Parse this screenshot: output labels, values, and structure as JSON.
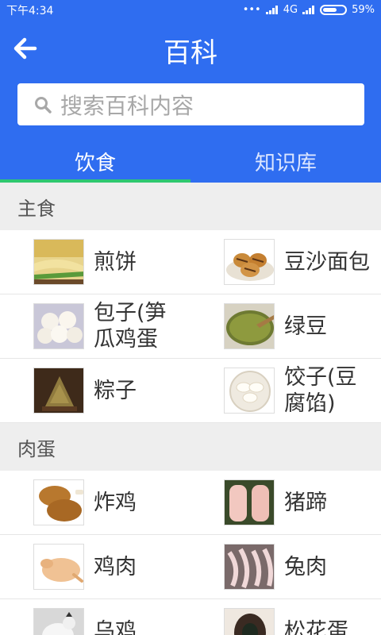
{
  "status": {
    "time": "下午4:34",
    "network": "4G",
    "battery": "59%"
  },
  "header": {
    "title": "百科",
    "back_icon": "arrow-left-icon"
  },
  "search": {
    "placeholder": "搜索百科内容",
    "icon": "search-icon"
  },
  "tabs": [
    {
      "label": "饮食",
      "active": true
    },
    {
      "label": "知识库",
      "active": false
    }
  ],
  "colors": {
    "primary": "#2f6df0",
    "indicator": "#2ec870",
    "section_bg": "#eeeeee"
  },
  "sections": [
    {
      "title": "主食",
      "rows": [
        [
          {
            "label": "煎饼"
          },
          {
            "label": "豆沙面包"
          }
        ],
        [
          {
            "label": "包子(笋瓜鸡蛋馅)"
          },
          {
            "label": "绿豆"
          }
        ],
        [
          {
            "label": "粽子"
          },
          {
            "label": "饺子(豆腐馅)"
          }
        ]
      ]
    },
    {
      "title": "肉蛋",
      "rows": [
        [
          {
            "label": "炸鸡"
          },
          {
            "label": "猪蹄"
          }
        ],
        [
          {
            "label": "鸡肉"
          },
          {
            "label": "兔肉"
          }
        ],
        [
          {
            "label": "乌鸡"
          },
          {
            "label": "松花蛋"
          }
        ]
      ]
    }
  ]
}
